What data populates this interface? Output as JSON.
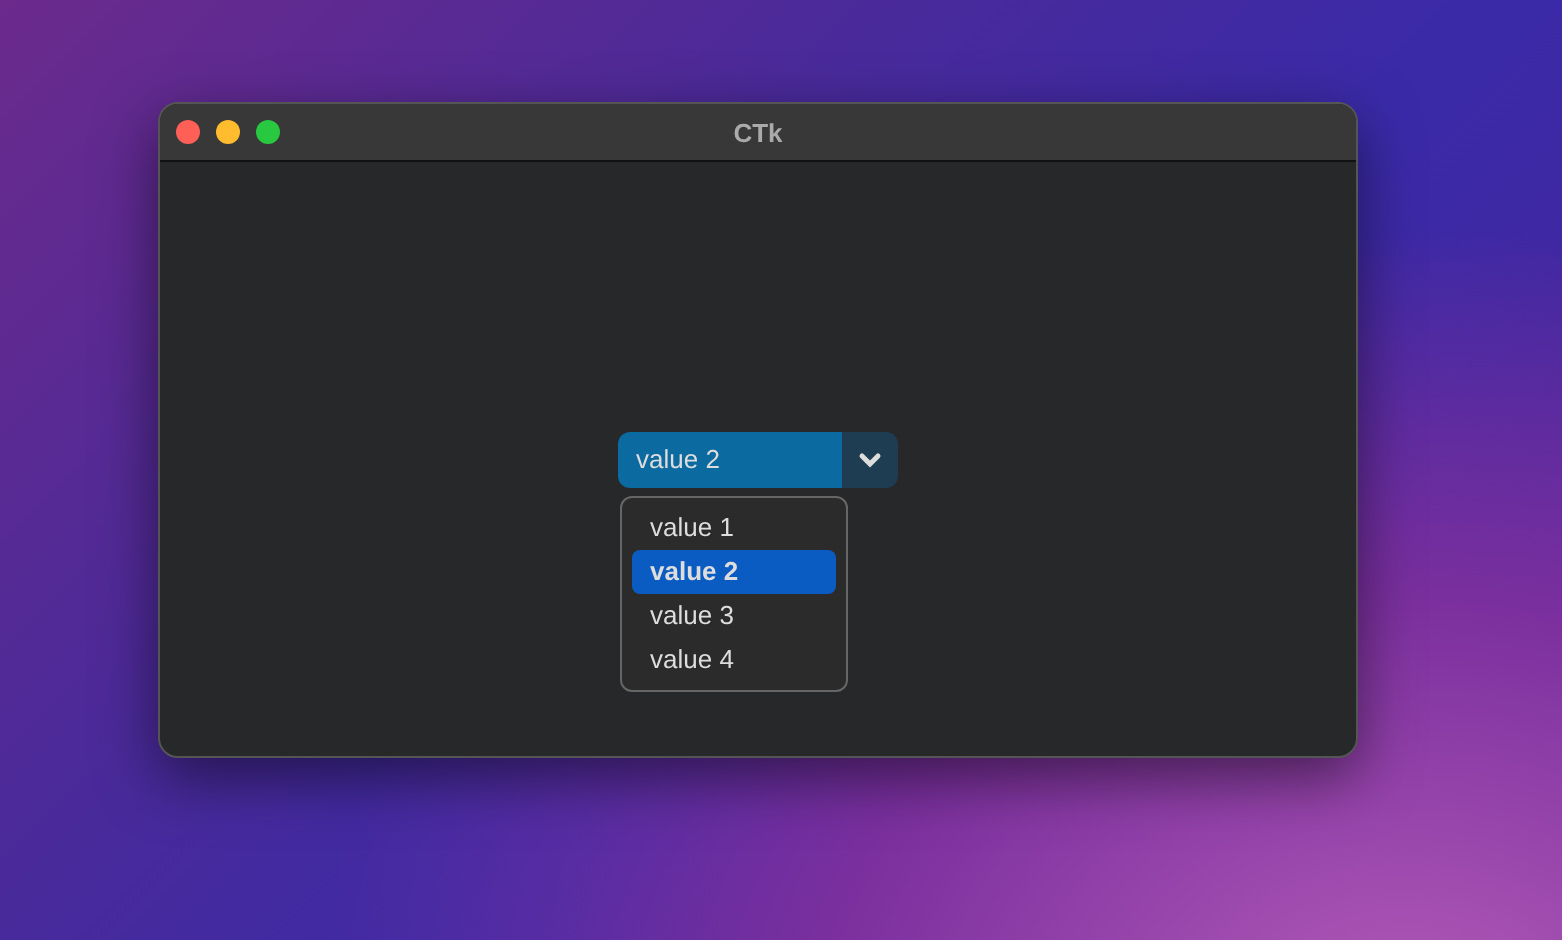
{
  "window": {
    "title": "CTk"
  },
  "combobox": {
    "value": "value 2",
    "expanded": true
  },
  "menu": [
    {
      "label": "value 1",
      "selected": false
    },
    {
      "label": "value 2",
      "selected": true
    },
    {
      "label": "value 3",
      "selected": false
    },
    {
      "label": "value 4",
      "selected": false
    }
  ]
}
